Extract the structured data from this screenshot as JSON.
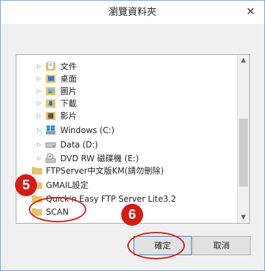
{
  "dialog": {
    "title": "瀏覽資料夾",
    "close_glyph": "✕"
  },
  "tree": {
    "items": [
      {
        "label": "文件",
        "icon": "documents-folder-icon",
        "expandable": true,
        "level": 2
      },
      {
        "label": "桌面",
        "icon": "desktop-folder-icon",
        "expandable": true,
        "level": 2
      },
      {
        "label": "圖片",
        "icon": "pictures-folder-icon",
        "expandable": true,
        "level": 2
      },
      {
        "label": "下載",
        "icon": "downloads-folder-icon",
        "expandable": true,
        "level": 2
      },
      {
        "label": "影片",
        "icon": "videos-folder-icon",
        "expandable": true,
        "level": 2
      },
      {
        "label": "Windows (C:)",
        "icon": "windows-drive-icon",
        "expandable": true,
        "level": 2
      },
      {
        "label": "Data (D:)",
        "icon": "hard-drive-icon",
        "expandable": true,
        "level": 2
      },
      {
        "label": "DVD RW 磁碟機 (E:)",
        "icon": "dvd-drive-icon",
        "expandable": true,
        "level": 2
      },
      {
        "label": "FTPServer中文版KM(請勿刪除)",
        "icon": "folder-icon",
        "expandable": false,
        "level": 1
      },
      {
        "label": "GMAIL設定",
        "icon": "folder-icon",
        "expandable": false,
        "level": 1
      },
      {
        "label": "Quick'n Easy FTP Server Lite3.2",
        "icon": "folder-icon",
        "expandable": false,
        "level": 1
      },
      {
        "label": "SCAN",
        "icon": "folder-icon",
        "expandable": false,
        "level": 1
      }
    ]
  },
  "buttons": {
    "ok": "確定",
    "cancel": "取消"
  },
  "annotations": {
    "step5": "5",
    "step6": "6",
    "color": "#d11d15"
  }
}
